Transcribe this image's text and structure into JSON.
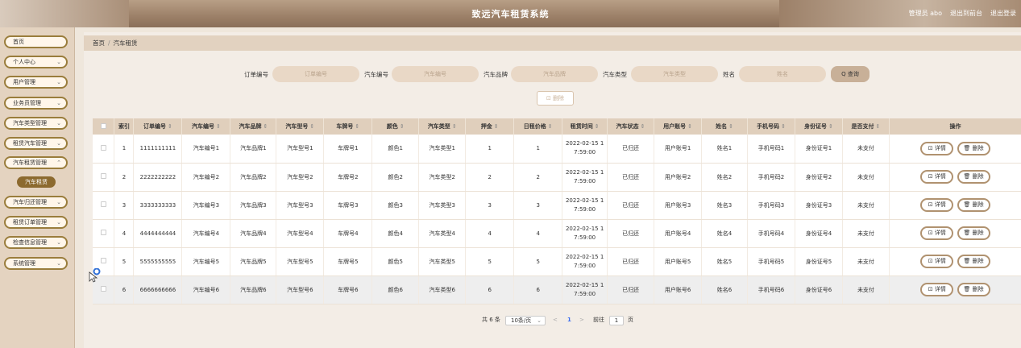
{
  "header": {
    "title": "致远汽车租赁系统",
    "admin": "管理员 abo",
    "to_front": "退出到前台",
    "logout": "退出登录"
  },
  "sidebar": {
    "items": [
      {
        "label": "首页"
      },
      {
        "label": "个人中心"
      },
      {
        "label": "用户管理"
      },
      {
        "label": "业务员管理"
      },
      {
        "label": "汽车类型管理"
      },
      {
        "label": "租赁汽车管理"
      },
      {
        "label": "汽车租赁管理"
      },
      {
        "label": "汽车归还管理"
      },
      {
        "label": "租赁订单管理"
      },
      {
        "label": "检查信息管理"
      },
      {
        "label": "系统管理"
      }
    ],
    "active_sub": "汽车租赁"
  },
  "breadcrumb": {
    "home": "首页",
    "sep": "/",
    "current": "汽车租赁"
  },
  "search": {
    "order_no_label": "订单编号",
    "order_no_placeholder": "订单编号",
    "car_no_label": "汽车编号",
    "car_no_placeholder": "汽车编号",
    "brand_label": "汽车品牌",
    "brand_placeholder": "汽车品牌",
    "type_label": "汽车类型",
    "type_placeholder": "汽车类型",
    "name_label": "姓名",
    "name_placeholder": "姓名",
    "query_button": "Q 查询"
  },
  "toolbar": {
    "delete_button": "⊡ 删除"
  },
  "table": {
    "headers": [
      "索引",
      "订单编号",
      "汽车编号",
      "汽车品牌",
      "汽车型号",
      "车牌号",
      "颜色",
      "汽车类型",
      "押金",
      "日租价格",
      "租赁时间",
      "汽车状态",
      "用户账号",
      "姓名",
      "手机号码",
      "身份证号",
      "是否支付",
      "操作"
    ],
    "rows": [
      {
        "idx": "1",
        "order": "1111111111",
        "car_no": "汽车编号1",
        "brand": "汽车品牌1",
        "model": "汽车型号1",
        "plate": "车牌号1",
        "color": "颜色1",
        "type": "汽车类型1",
        "deposit": "1",
        "price": "1",
        "time1": "2022-02-15 1",
        "time2": "7:59:00",
        "status": "已归还",
        "account": "用户账号1",
        "name": "姓名1",
        "phone": "手机号码1",
        "id_no": "身份证号1",
        "paid": "未支付"
      },
      {
        "idx": "2",
        "order": "2222222222",
        "car_no": "汽车编号2",
        "brand": "汽车品牌2",
        "model": "汽车型号2",
        "plate": "车牌号2",
        "color": "颜色2",
        "type": "汽车类型2",
        "deposit": "2",
        "price": "2",
        "time1": "2022-02-15 1",
        "time2": "7:59:00",
        "status": "已归还",
        "account": "用户账号2",
        "name": "姓名2",
        "phone": "手机号码2",
        "id_no": "身份证号2",
        "paid": "未支付"
      },
      {
        "idx": "3",
        "order": "3333333333",
        "car_no": "汽车编号3",
        "brand": "汽车品牌3",
        "model": "汽车型号3",
        "plate": "车牌号3",
        "color": "颜色3",
        "type": "汽车类型3",
        "deposit": "3",
        "price": "3",
        "time1": "2022-02-15 1",
        "time2": "7:59:00",
        "status": "已归还",
        "account": "用户账号3",
        "name": "姓名3",
        "phone": "手机号码3",
        "id_no": "身份证号3",
        "paid": "未支付"
      },
      {
        "idx": "4",
        "order": "4444444444",
        "car_no": "汽车编号4",
        "brand": "汽车品牌4",
        "model": "汽车型号4",
        "plate": "车牌号4",
        "color": "颜色4",
        "type": "汽车类型4",
        "deposit": "4",
        "price": "4",
        "time1": "2022-02-15 1",
        "time2": "7:59:00",
        "status": "已归还",
        "account": "用户账号4",
        "name": "姓名4",
        "phone": "手机号码4",
        "id_no": "身份证号4",
        "paid": "未支付"
      },
      {
        "idx": "5",
        "order": "5555555555",
        "car_no": "汽车编号5",
        "brand": "汽车品牌5",
        "model": "汽车型号5",
        "plate": "车牌号5",
        "color": "颜色5",
        "type": "汽车类型5",
        "deposit": "5",
        "price": "5",
        "time1": "2022-02-15 1",
        "time2": "7:59:00",
        "status": "已归还",
        "account": "用户账号5",
        "name": "姓名5",
        "phone": "手机号码5",
        "id_no": "身份证号5",
        "paid": "未支付"
      },
      {
        "idx": "6",
        "order": "6666666666",
        "car_no": "汽车编号6",
        "brand": "汽车品牌6",
        "model": "汽车型号6",
        "plate": "车牌号6",
        "color": "颜色6",
        "type": "汽车类型6",
        "deposit": "6",
        "price": "6",
        "time1": "2022-02-15 1",
        "time2": "7:59:00",
        "status": "已归还",
        "account": "用户账号6",
        "name": "姓名6",
        "phone": "手机号码6",
        "id_no": "身份证号6",
        "paid": "未支付"
      }
    ],
    "detail_label": "⊡ 详情",
    "delete_label": "🗑 删除"
  },
  "pager": {
    "total": "共 6 条",
    "page_size": "10条/页",
    "prev": "<",
    "current": "1",
    "next": ">",
    "goto": "前往",
    "goto_value": "1",
    "page_suffix": "页"
  },
  "colors": {
    "accent": "#8c6a2f",
    "header_bar": "#9c8068",
    "table_head": "#e0cfbc",
    "link": "#3a6df0"
  }
}
